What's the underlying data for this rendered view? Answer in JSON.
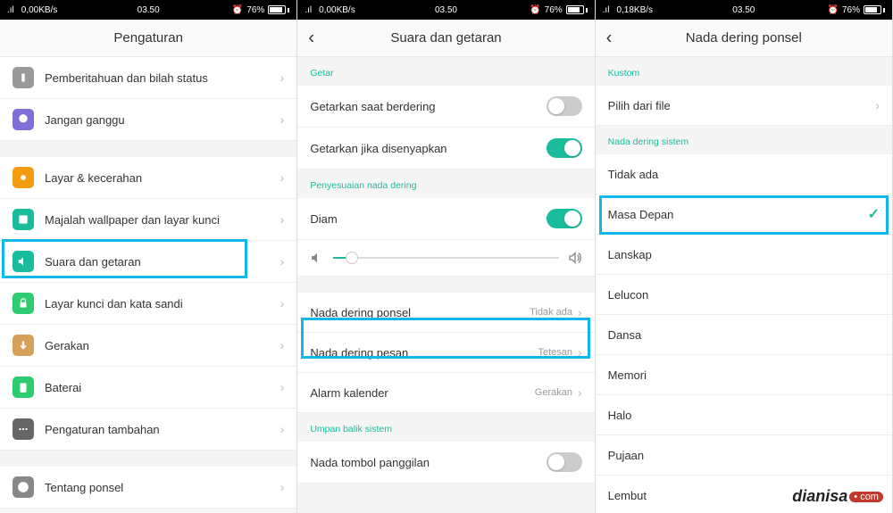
{
  "statusbar": {
    "speed1": "0,00KB/s",
    "speed3": "0,18KB/s",
    "time": "03.50",
    "battery_pct": "76%"
  },
  "screen1": {
    "title": "Pengaturan",
    "items": [
      {
        "label": "Pemberitahuan dan bilah status"
      },
      {
        "label": "Jangan ganggu"
      },
      {
        "label": "Layar &  kecerahan"
      },
      {
        "label": "Majalah wallpaper dan layar kunci"
      },
      {
        "label": "Suara dan getaran"
      },
      {
        "label": "Layar kunci dan kata sandi"
      },
      {
        "label": "Gerakan"
      },
      {
        "label": "Baterai"
      },
      {
        "label": "Pengaturan tambahan"
      },
      {
        "label": "Tentang ponsel"
      }
    ]
  },
  "screen2": {
    "title": "Suara dan getaran",
    "sections": {
      "getar": "Getar",
      "penyesuaian": "Penyesuaian nada dering",
      "umpan": "Umpan balik sistem"
    },
    "rows": {
      "vibrate_ring": "Getarkan saat berdering",
      "vibrate_silent": "Getarkan jika disenyapkan",
      "diam": "Diam",
      "ringtone": "Nada dering ponsel",
      "ringtone_val": "Tidak ada",
      "msg_tone": "Nada dering pesan",
      "msg_val": "Tetesan",
      "alarm": "Alarm kalender",
      "alarm_val": "Gerakan",
      "dial": "Nada tombol panggilan"
    }
  },
  "screen3": {
    "title": "Nada dering ponsel",
    "sections": {
      "kustom": "Kustom",
      "sistem": "Nada dering sistem"
    },
    "rows": {
      "file": "Pilih dari file",
      "options": [
        "Tidak ada",
        "Masa Depan",
        "Lanskap",
        "Lelucon",
        "Dansa",
        "Memori",
        "Halo",
        "Pujaan",
        "Lembut"
      ]
    },
    "selected_index": 1
  },
  "watermark": {
    "brand": "dianisa",
    "suffix": "• com"
  }
}
